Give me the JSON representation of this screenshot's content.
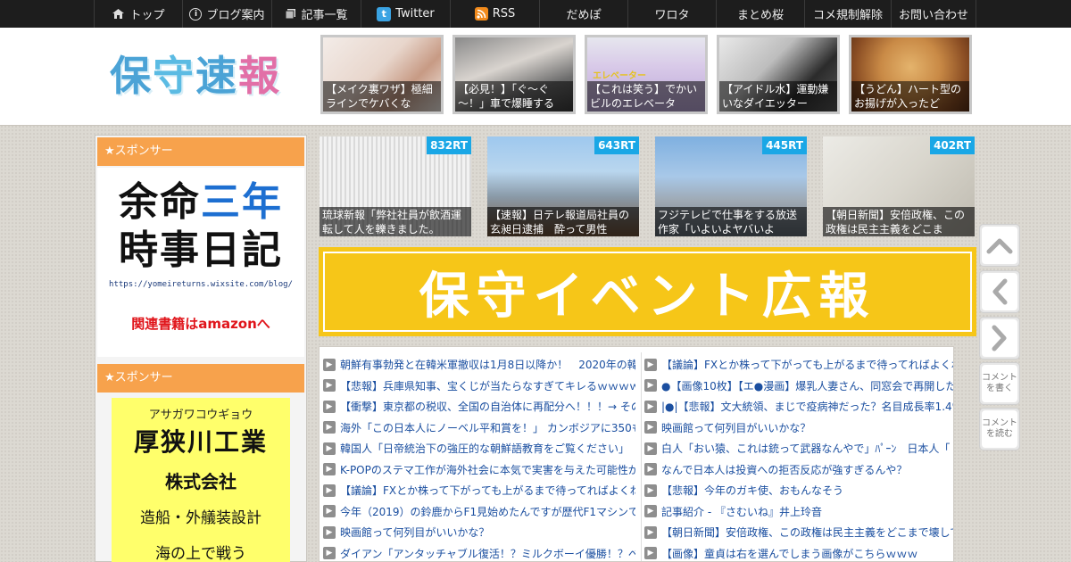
{
  "nav": [
    {
      "label": "トップ",
      "icon": "home-icon"
    },
    {
      "label": "ブログ案内",
      "icon": "info-icon"
    },
    {
      "label": "記事一覧",
      "icon": "list-icon"
    },
    {
      "label": "Twitter",
      "icon": "twitter-icon"
    },
    {
      "label": "RSS",
      "icon": "rss-icon"
    },
    {
      "label": "だめぽ"
    },
    {
      "label": "ワロタ"
    },
    {
      "label": "まとめ桜"
    },
    {
      "label": "コメ規制解除"
    },
    {
      "label": "お問い合わせ"
    }
  ],
  "logo": {
    "c1": "保",
    "c2": "守",
    "c3": "速",
    "c4": "報"
  },
  "header_thumbs": [
    {
      "caption": "【メイク裏ワザ】極細ラインでケバくな",
      "overlay": ""
    },
    {
      "caption": "【必見！】「ぐ～ぐ～！」車で爆睡する",
      "overlay": ""
    },
    {
      "caption": "【これは笑う】でかいビルのエレベータ",
      "overlay": "エレベーター"
    },
    {
      "caption": "【アイドル水】運動嫌いなダイエッター",
      "overlay": ""
    },
    {
      "caption": "【うどん】ハート型のお揚げが入ったど",
      "overlay": ""
    }
  ],
  "sidebar": {
    "sponsor_label": "★スポンサー",
    "sponsor_label2": "★スポンサー",
    "yomei": {
      "l1a": "余命",
      "l1b": "三年",
      "l2": "時事日記",
      "url": "https://yomeireturns.wixsite.com/blog/",
      "amazon": "関連書籍はamazonへ"
    },
    "asagawa": {
      "kana": "アサガワコウギョウ",
      "name": "厚狭川工業",
      "kk": "株式会社",
      "desc": "造船・外艤装設計",
      "more": "海の上で戦う"
    }
  },
  "rt_thumbs": [
    {
      "badge": "832RT",
      "caption": "琉球新報「弊社社員が飲酒運転して人を轢きました。"
    },
    {
      "badge": "643RT",
      "caption": "【速報】日テレ報道局社員の玄昶日逮捕　酔って男性"
    },
    {
      "badge": "445RT",
      "caption": "フジテレビで仕事をする放送作家「いよいよヤバいよ"
    },
    {
      "badge": "402RT",
      "caption": "【朝日新聞】安倍政権、この政権は民主主義をどこま"
    }
  ],
  "banner": {
    "text": "保守イベント広報"
  },
  "articles_left": [
    "朝鮮有事勃発と在韓米軍撤収は1月8日以降か！　2020年の韓国",
    "【悲報】兵庫県知事、宝くじが当たらなすぎてキレるｗｗｗｗｗ",
    "【衝撃】東京都の税収、全国の自治体に再配分へ！！！→ その",
    "海外「この日本人にノーベル平和賞を！」 カンボジアに350も",
    "韓国人「日帝統治下の強圧的な朝鮮語教育をご覧ください」",
    "K-POPのステマ工作が海外社会に本気で実害を与えた可能性が",
    "【議論】FXとか株って下がっても上がるまで待ってればよくね",
    "今年（2019）の鈴鹿からF1見始めたんですが歴代F1マシンでも",
    "映画館って何列目がいいかな？",
    "ダイアン「アンタッチャブル復活！？ミルクボーイ優勝！？べ"
  ],
  "articles_right": [
    "【議論】FXとか株って下がっても上がるまで待ってればよくね",
    "●【画像10枚】【エ●漫画】爆乳人妻さん、同窓会で再開した同",
    "|●|【悲報】文大統領、まじで疫病神だった？名目成長率1.4％（",
    "映画館って何列目がいいかな？",
    "白人「おい猿、これは銃って武器なんやで」ﾊﾟｰﾝ　日本人「",
    "なんで日本人は投資への拒否反応が強すぎるんや？",
    "【悲報】今年のガキ使、おもんなそう",
    "記事紹介 - 『さむいね』井上玲音",
    "【朝日新聞】安倍政権、この政権は民主主義をどこまで壊して",
    "【画像】童貞は右を選んでしまう画像がこちらｗｗｗ"
  ],
  "side_buttons": {
    "top": "^",
    "prev": "<",
    "next": ">",
    "write": "コメントを書く",
    "read": "コメントを読む"
  }
}
